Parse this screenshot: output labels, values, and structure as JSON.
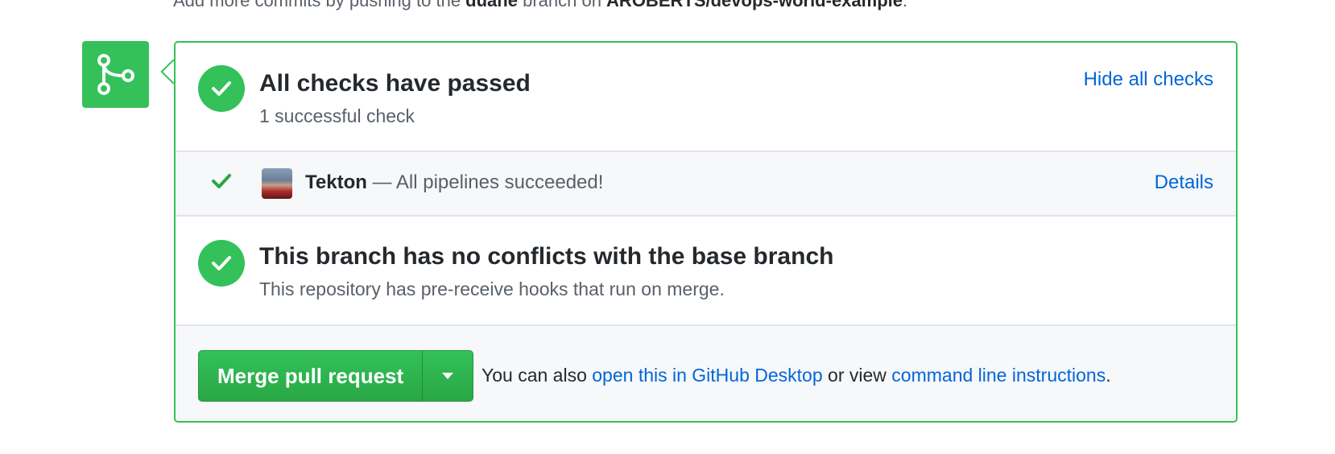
{
  "top_note": {
    "prefix": "Add more commits by pushing to the ",
    "branch": "duane",
    "middle": " branch on ",
    "repo": "AROBERTS/devops-world-example",
    "suffix": "."
  },
  "checks": {
    "title": "All checks have passed",
    "subtitle": "1 successful check",
    "toggle_label": "Hide all checks"
  },
  "check_item": {
    "name": "Tekton",
    "description": " — All pipelines succeeded!",
    "details_label": "Details"
  },
  "conflicts": {
    "title": "This branch has no conflicts with the base branch",
    "subtitle": "This repository has pre-receive hooks that run on merge."
  },
  "merge": {
    "button_label": "Merge pull request",
    "msg_prefix": "You can also ",
    "desktop_link": "open this in GitHub Desktop",
    "msg_middle": " or view ",
    "cli_link": "command line instructions",
    "msg_suffix": "."
  },
  "colors": {
    "success": "#34c15a",
    "link": "#0366d6",
    "muted": "#586069"
  },
  "icons": {
    "badge": "git-merge-icon",
    "status": "check-circle-icon",
    "check": "check-icon",
    "caret": "triangle-down-icon"
  }
}
